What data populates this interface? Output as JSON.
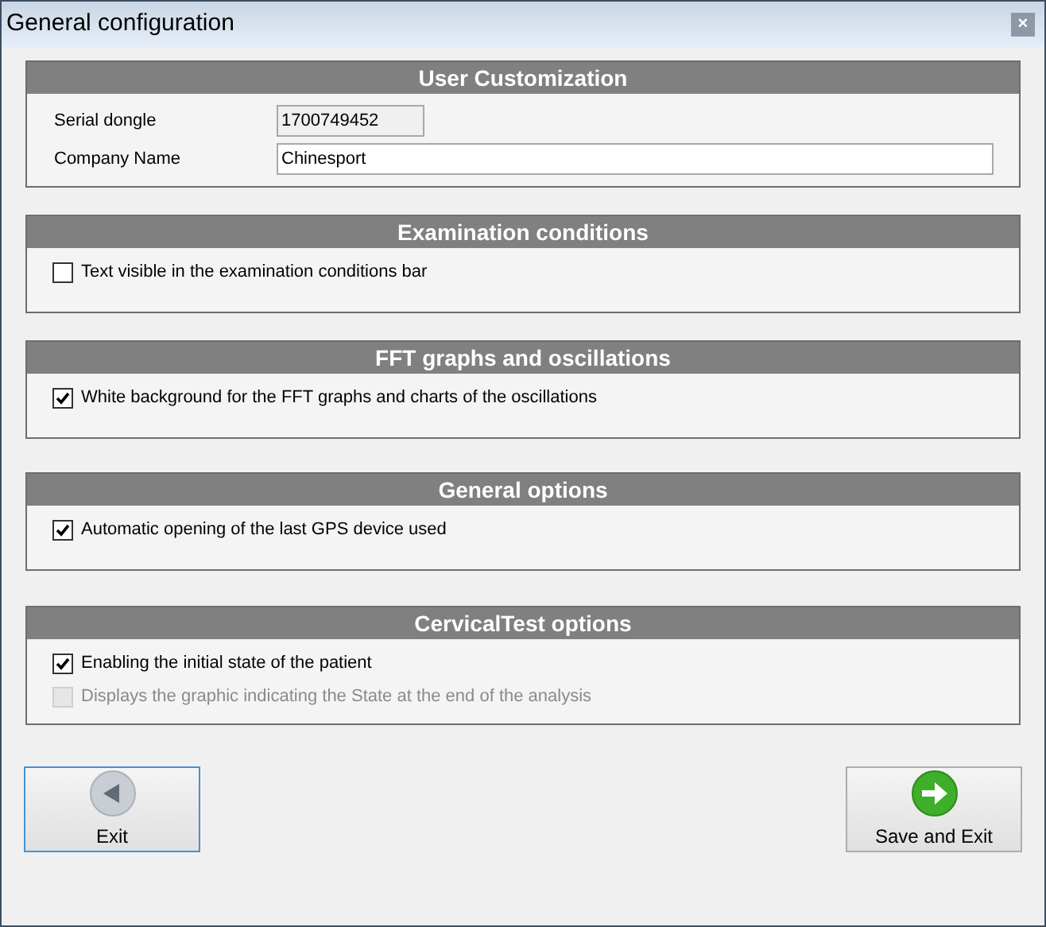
{
  "window": {
    "title": "General configuration",
    "close": "×"
  },
  "sections": [
    {
      "title": "User Customization",
      "items": [
        {
          "kind": "field",
          "label": "Serial dongle",
          "value": "1700749452",
          "disabled": true
        },
        {
          "kind": "field",
          "label": "Company Name",
          "value": "Chinesport",
          "disabled": false
        }
      ]
    },
    {
      "title": "Examination conditions",
      "items": [
        {
          "kind": "checkbox",
          "label": "Text visible in the examination conditions bar",
          "checked": false,
          "disabled": false
        }
      ]
    },
    {
      "title": "FFT graphs and oscillations",
      "items": [
        {
          "kind": "checkbox",
          "label": "White background for the FFT graphs and charts of the oscillations",
          "checked": true,
          "disabled": false
        }
      ]
    },
    {
      "title": "General options",
      "items": [
        {
          "kind": "checkbox",
          "label": "Automatic opening of the last GPS device used",
          "checked": true,
          "disabled": false
        }
      ]
    },
    {
      "title": "CervicalTest options",
      "items": [
        {
          "kind": "checkbox",
          "label": "Enabling the initial state of the patient",
          "checked": true,
          "disabled": false
        },
        {
          "kind": "checkbox",
          "label": "Displays the graphic indicating the State at the end of the analysis",
          "checked": false,
          "disabled": true
        }
      ]
    }
  ],
  "buttons": [
    {
      "kind": "back",
      "label": "Exit",
      "selected": true
    },
    {
      "kind": "forward",
      "label": "Save and Exit",
      "selected": false
    }
  ]
}
